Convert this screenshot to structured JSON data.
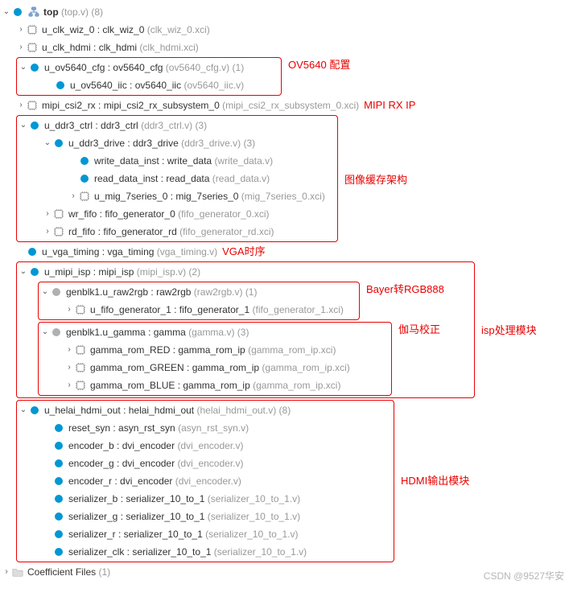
{
  "top": {
    "label": "top",
    "file": "(top.v)",
    "count": "(8)"
  },
  "clk_wiz": {
    "label": "u_clk_wiz_0 : clk_wiz_0",
    "file": "(clk_wiz_0.xci)"
  },
  "clk_hdmi": {
    "label": "u_clk_hdmi : clk_hdmi",
    "file": "(clk_hdmi.xci)"
  },
  "ov5640_cfg": {
    "label": "u_ov5640_cfg : ov5640_cfg",
    "file": "(ov5640_cfg.v)",
    "count": "(1)"
  },
  "ov5640_iic": {
    "label": "u_ov5640_iic : ov5640_iic",
    "file": "(ov5640_iic.v)"
  },
  "mipi_rx": {
    "label": "mipi_csi2_rx : mipi_csi2_rx_subsystem_0",
    "file": "(mipi_csi2_rx_subsystem_0.xci)"
  },
  "ddr3_ctrl": {
    "label": "u_ddr3_ctrl : ddr3_ctrl",
    "file": "(ddr3_ctrl.v)",
    "count": "(3)"
  },
  "ddr3_drive": {
    "label": "u_ddr3_drive : ddr3_drive",
    "file": "(ddr3_drive.v)",
    "count": "(3)"
  },
  "write_data": {
    "label": "write_data_inst : write_data",
    "file": "(write_data.v)"
  },
  "read_data": {
    "label": "read_data_inst : read_data",
    "file": "(read_data.v)"
  },
  "mig": {
    "label": "u_mig_7series_0 : mig_7series_0",
    "file": "(mig_7series_0.xci)"
  },
  "wr_fifo": {
    "label": "wr_fifo : fifo_generator_0",
    "file": "(fifo_generator_0.xci)"
  },
  "rd_fifo": {
    "label": "rd_fifo : fifo_generator_rd",
    "file": "(fifo_generator_rd.xci)"
  },
  "vga": {
    "label": "u_vga_timing : vga_timing",
    "file": "(vga_timing.v)"
  },
  "mipi_isp": {
    "label": "u_mipi_isp : mipi_isp",
    "file": "(mipi_isp.v)",
    "count": "(2)"
  },
  "raw2rgb": {
    "label": "genblk1.u_raw2rgb : raw2rgb",
    "file": "(raw2rgb.v)",
    "count": "(1)"
  },
  "fifo1": {
    "label": "u_fifo_generator_1 : fifo_generator_1",
    "file": "(fifo_generator_1.xci)"
  },
  "gamma": {
    "label": "genblk1.u_gamma : gamma",
    "file": "(gamma.v)",
    "count": "(3)"
  },
  "gamma_r": {
    "label": "gamma_rom_RED : gamma_rom_ip",
    "file": "(gamma_rom_ip.xci)"
  },
  "gamma_g": {
    "label": "gamma_rom_GREEN : gamma_rom_ip",
    "file": "(gamma_rom_ip.xci)"
  },
  "gamma_b": {
    "label": "gamma_rom_BLUE : gamma_rom_ip",
    "file": "(gamma_rom_ip.xci)"
  },
  "hdmi_out": {
    "label": "u_helai_hdmi_out : helai_hdmi_out",
    "file": "(helai_hdmi_out.v)",
    "count": "(8)"
  },
  "reset_syn": {
    "label": "reset_syn : asyn_rst_syn",
    "file": "(asyn_rst_syn.v)"
  },
  "enc_b": {
    "label": "encoder_b : dvi_encoder",
    "file": "(dvi_encoder.v)"
  },
  "enc_g": {
    "label": "encoder_g : dvi_encoder",
    "file": "(dvi_encoder.v)"
  },
  "enc_r": {
    "label": "encoder_r : dvi_encoder",
    "file": "(dvi_encoder.v)"
  },
  "ser_b": {
    "label": "serializer_b : serializer_10_to_1",
    "file": "(serializer_10_to_1.v)"
  },
  "ser_g": {
    "label": "serializer_g : serializer_10_to_1",
    "file": "(serializer_10_to_1.v)"
  },
  "ser_r": {
    "label": "serializer_r : serializer_10_to_1",
    "file": "(serializer_10_to_1.v)"
  },
  "ser_clk": {
    "label": "serializer_clk : serializer_10_to_1",
    "file": "(serializer_10_to_1.v)"
  },
  "coeff": {
    "label": "Coefficient Files",
    "count": "(1)"
  },
  "ann": {
    "ov5640": "OV5640 配置",
    "mipi_rx": "MIPI RX IP",
    "ddr": "图像缓存架构",
    "vga": "VGA时序",
    "bayer": "Bayer转RGB888",
    "gamma": "伽马校正",
    "isp": "isp处理模块",
    "hdmi": "HDMI输出模块"
  },
  "watermark": "CSDN @9527华安"
}
